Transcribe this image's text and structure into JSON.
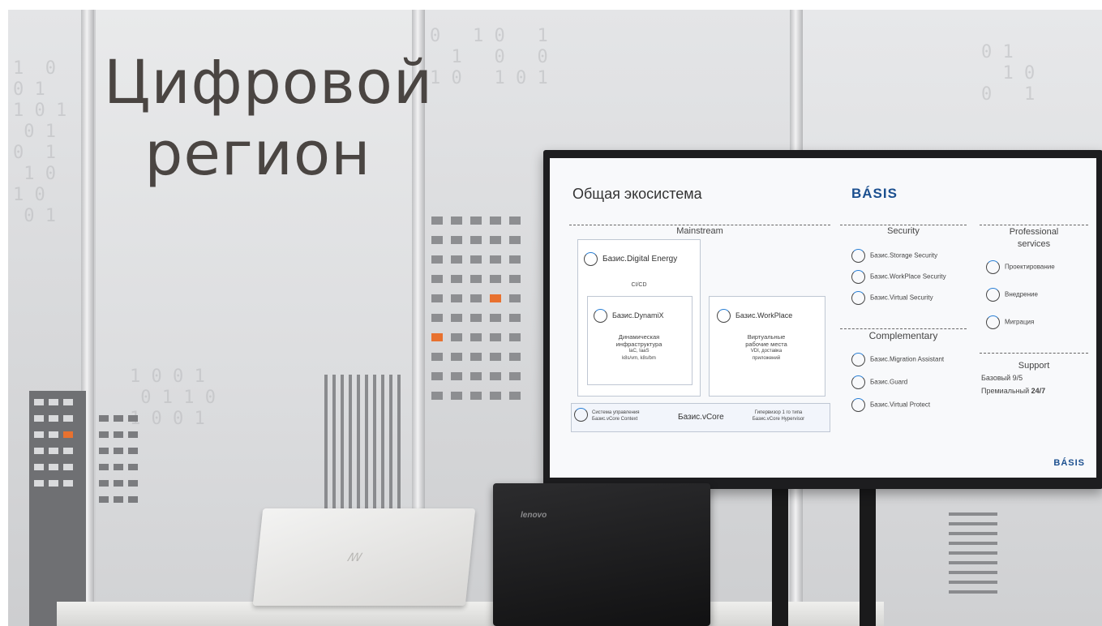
{
  "wall": {
    "line1": "Цифровой",
    "line2": "регион"
  },
  "slide": {
    "title": "Общая экосистема",
    "logo": "BÁSIS",
    "mainstream": {
      "label": "Mainstream",
      "digital_energy": "Базис.Digital Energy",
      "cicd": "CI/CD",
      "dynamix": "Базис.DynamiX",
      "dynamix_desc1": "Динамическая",
      "dynamix_desc2": "инфраструктура",
      "dynamix_desc3": "IaC, IaaS",
      "dynamix_desc4": "k8s/vm, k8s/bm",
      "workplace": "Базис.WorkPlace",
      "workplace_desc1": "Виртуальные",
      "workplace_desc2": "рабочие места",
      "workplace_desc3": "VDI, доставка",
      "workplace_desc4": "приложений",
      "vcore_left1": "Система управления",
      "vcore_left2": "Базис.vCore Context",
      "vcore": "Базис.vCore",
      "vcore_right1": "Гипервизор 1 го типа",
      "vcore_right2": "Базис.vCore Hypervisor"
    },
    "security": {
      "label": "Security",
      "items": [
        "Базис.Storage Security",
        "Базис.WorkPlace Security",
        "Базис.Virtual Security"
      ]
    },
    "complementary": {
      "label": "Complementary",
      "items": [
        "Базис.Migration Assistant",
        "Базис.Guard",
        "Базис.Virtual Protect"
      ]
    },
    "professional": {
      "label1": "Professional",
      "label2": "services",
      "items": [
        "Проектирование",
        "Внедрение",
        "Миграция"
      ]
    },
    "support": {
      "label": "Support",
      "basic": "Базовый 9/5",
      "premium_prefix": "Премиальный",
      "premium_hours": "24/7"
    }
  },
  "laptop": {
    "brand": "lenovo"
  },
  "colors": {
    "accent_orange": "#e8712f",
    "logo_blue": "#1b4f8f",
    "wall_text": "#4a4542"
  }
}
